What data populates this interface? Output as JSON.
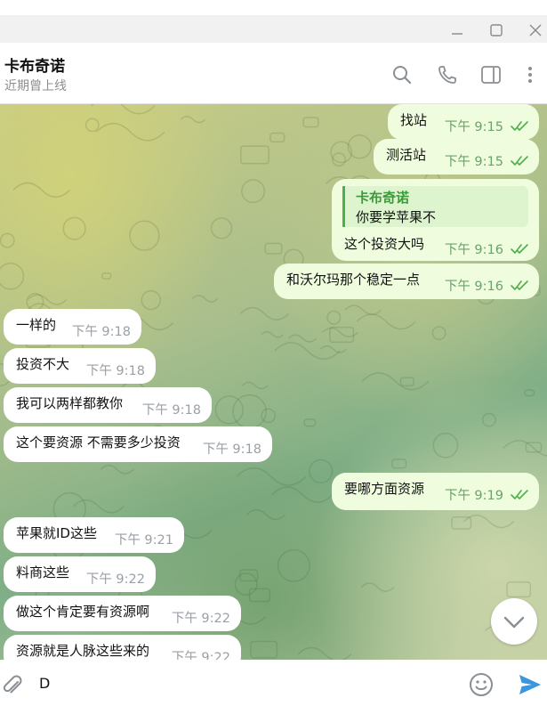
{
  "window": {
    "controls": [
      "minimize",
      "maximize",
      "close"
    ]
  },
  "header": {
    "name": "卡布奇诺",
    "status": "近期曾上线",
    "icons": [
      "search-icon",
      "phone-icon",
      "sidebar-toggle-icon",
      "more-vert-icon"
    ]
  },
  "messages": [
    {
      "dir": "out",
      "text": "找站",
      "time": "下午 9:15",
      "read": true
    },
    {
      "dir": "out",
      "text": "测活站",
      "time": "下午 9:15",
      "read": true
    },
    {
      "dir": "out",
      "reply": {
        "name": "卡布奇诺",
        "text": "你要学苹果不"
      },
      "text": "这个投资大吗",
      "time": "下午 9:16",
      "read": true
    },
    {
      "dir": "out",
      "text": "和沃尔玛那个稳定一点",
      "time": "下午 9:16",
      "read": true
    },
    {
      "dir": "in",
      "text": "一样的",
      "time": "下午 9:18"
    },
    {
      "dir": "in",
      "text": "投资不大",
      "time": "下午 9:18"
    },
    {
      "dir": "in",
      "text": "我可以两样都教你",
      "time": "下午 9:18"
    },
    {
      "dir": "in",
      "text": "这个要资源 不需要多少投资",
      "time": "下午 9:18"
    },
    {
      "dir": "out",
      "text": "要哪方面资源",
      "time": "下午 9:19",
      "read": true
    },
    {
      "dir": "in",
      "text": "苹果就ID这些",
      "time": "下午 9:21"
    },
    {
      "dir": "in",
      "text": "料商这些",
      "time": "下午 9:22"
    },
    {
      "dir": "in",
      "text": "做这个肯定要有资源啊",
      "time": "下午 9:22"
    },
    {
      "dir": "in",
      "text": "资源就是人脉这些来的",
      "time": "下午 9:22"
    }
  ],
  "composer": {
    "value": "D",
    "icons": [
      "attach-icon",
      "emoji-icon",
      "send-icon"
    ]
  },
  "colors": {
    "outgoing_bubble": "#effdde",
    "incoming_bubble": "#ffffff",
    "accent": "#3a96dd",
    "tick": "#4fae4e"
  }
}
